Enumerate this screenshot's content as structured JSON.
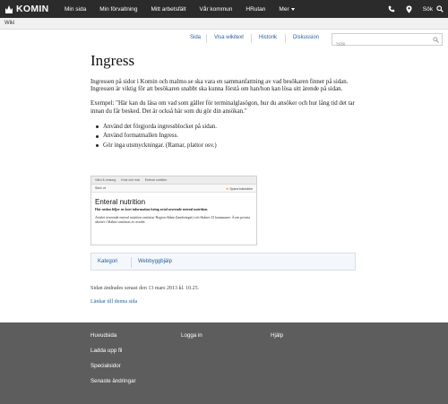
{
  "topbar": {
    "logo_text": "KOMIN",
    "nav": [
      "Min sida",
      "Min förvaltning",
      "Mitt arbetsfält",
      "Vår kommun",
      "HRutan"
    ],
    "more_label": "Mer",
    "search_label": "Sök"
  },
  "breadcrumb": "Wiki",
  "tabs": [
    "Sida",
    "Visa wikitext",
    "Historik",
    "Diskussion"
  ],
  "search": {
    "placeholder": "Sök"
  },
  "article": {
    "title": "Ingress",
    "para1": "Ingressen på sidor i Komin och malmo.se ska vara en sammanfattning av vad besökaren finner på sidan. Ingressen är viktig för att besökaren snabbt ska kunna förstå om han/hon kan lösa sitt ärende på sidan.",
    "para2": "Exempel: \"Här kan du läsa om vad som gäller för terminalglasögon, hur du ansöker och hur lång tid det tar innan du får besked. Det är också här som du gör din ansökan.\"",
    "bullets": [
      "Använd det förgjorda ingressblocket på sidan.",
      "Använd formatmallen Ingress.",
      "Gör inga utsmyckningar. (Ramar, plattor osv.)"
    ]
  },
  "screenshot": {
    "crumbs": [
      "Vård & omsorg",
      "Kost och mat",
      "Enteral nutrition"
    ],
    "print_label": "Skriv ut",
    "bookmark_label": "Spara bokmärke",
    "heading": "Enteral nutrition",
    "lead": "Här nedan följer en kort information kring avtal avseende enteral nutrition.",
    "body": "Avtalet avseende enteral nutrition omfattar Region Skåne (landstinget) och Skånes 33 kommuner. Även privata aktörer i Malmö omfattas av avtalet."
  },
  "categories": {
    "label": "Kategori",
    "items": [
      "Webbyggbjälp"
    ]
  },
  "meta": {
    "changed": "Sidan ändrades senast den 13 mars 2013 kl. 10.25.",
    "permalink": "Länkar till denna sida"
  },
  "footer": {
    "col1": [
      "Huvudsida",
      "Ladda upp fil",
      "Specialsidor",
      "Senaste ändringar"
    ],
    "col2": [
      "Logga in"
    ],
    "col3": [
      "Hjälp"
    ]
  },
  "colors": {
    "topbar": "#2b2b2b",
    "footer": "#5d5d5d",
    "link": "#2a5d9f"
  },
  "icons": [
    "komin-logo-icon",
    "phone-icon",
    "location-pin-icon",
    "search-icon",
    "chevron-down-icon"
  ]
}
